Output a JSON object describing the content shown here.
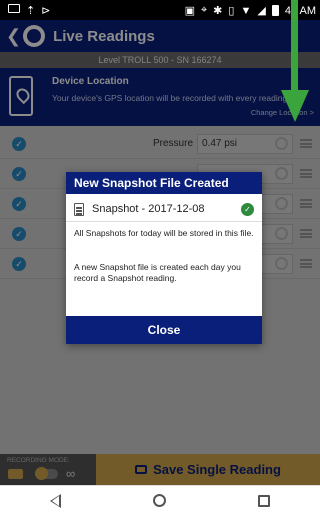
{
  "statusbar": {
    "time": "48 AM",
    "left_icons": [
      "screen-record-icon",
      "upload-icon",
      "arrow-icon"
    ],
    "right_icons": [
      "cast-icon",
      "location-icon",
      "bluetooth-icon",
      "vibrate-icon",
      "wifi-icon",
      "signal-icon",
      "battery-icon"
    ]
  },
  "header": {
    "title": "Live Readings",
    "subtitle": "Level TROLL 500 - SN 166274"
  },
  "gps_panel": {
    "title": "Device Location",
    "text": "Your device's GPS location will be recorded with every reading",
    "link": "Change Location >"
  },
  "readings": [
    {
      "label": "Pressure",
      "value": "0.47 psi"
    },
    {
      "label": "",
      "value": ""
    },
    {
      "label": "",
      "value": ""
    },
    {
      "label": "",
      "value": ""
    },
    {
      "label": "",
      "value": ""
    }
  ],
  "dialog": {
    "title": "New Snapshot File Created",
    "file_name": "Snapshot - 2017-12-08",
    "text1": "All Snapshots for today will be stored in this file.",
    "text2": "A new Snapshot file is created each day you record a Snapshot reading.",
    "close_label": "Close"
  },
  "bottom": {
    "recording_mode_label": "RECORDING MODE:",
    "infinity": "∞",
    "save_label": "Save Single Reading"
  },
  "colors": {
    "brand_blue": "#0a1f7a",
    "accent_gold": "#cfa64a",
    "check_blue": "#2b89c4",
    "success_green": "#2e8b3e",
    "annotation_green": "#3ca43c"
  }
}
